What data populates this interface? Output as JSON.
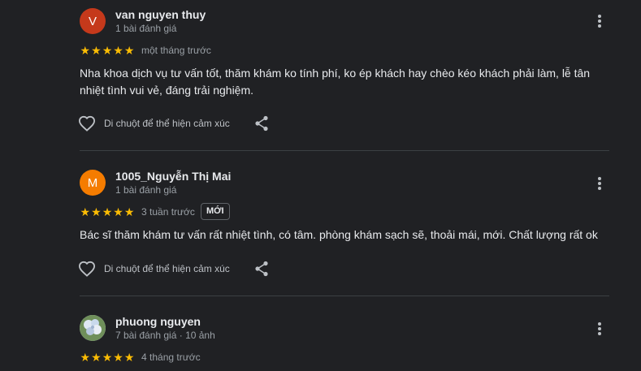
{
  "reviews": [
    {
      "initial": "V",
      "avatar_color": "#c5391b",
      "name": "van nguyen thuy",
      "meta": "1 bài đánh giá",
      "rating": 5,
      "date": "một tháng trước",
      "badge": "",
      "text": "Nha khoa dịch vụ tư vấn tốt, thăm khám ko tính phí, ko ép khách hay chèo kéo khách phải làm, lễ tân nhiệt tình vui vẻ, đáng trải nghiệm.",
      "like_label": "Di chuột để thể hiện cảm xúc"
    },
    {
      "initial": "M",
      "avatar_color": "#f57c00",
      "name": "1005_Nguyễn Thị Mai",
      "meta": "1 bài đánh giá",
      "rating": 5,
      "date": "3 tuần trước",
      "badge": "MỚI",
      "text": "Bác sĩ thăm khám tư vấn rất nhiệt tình, có tâm. phòng khám sạch sẽ, thoải mái, mới. Chất lượng rất ok",
      "like_label": "Di chuột để thể hiện cảm xúc"
    },
    {
      "initial": "",
      "avatar_color": "#c7d6e6",
      "name": "phuong nguyen",
      "meta": "7 bài đánh giá · 10 ảnh",
      "rating": 5,
      "date": "4 tháng trước",
      "badge": "",
      "text": "",
      "like_label": ""
    }
  ],
  "icons": {
    "star": "star-icon",
    "more": "more-vert-icon",
    "like": "heart-outline-icon",
    "share": "share-icon"
  }
}
